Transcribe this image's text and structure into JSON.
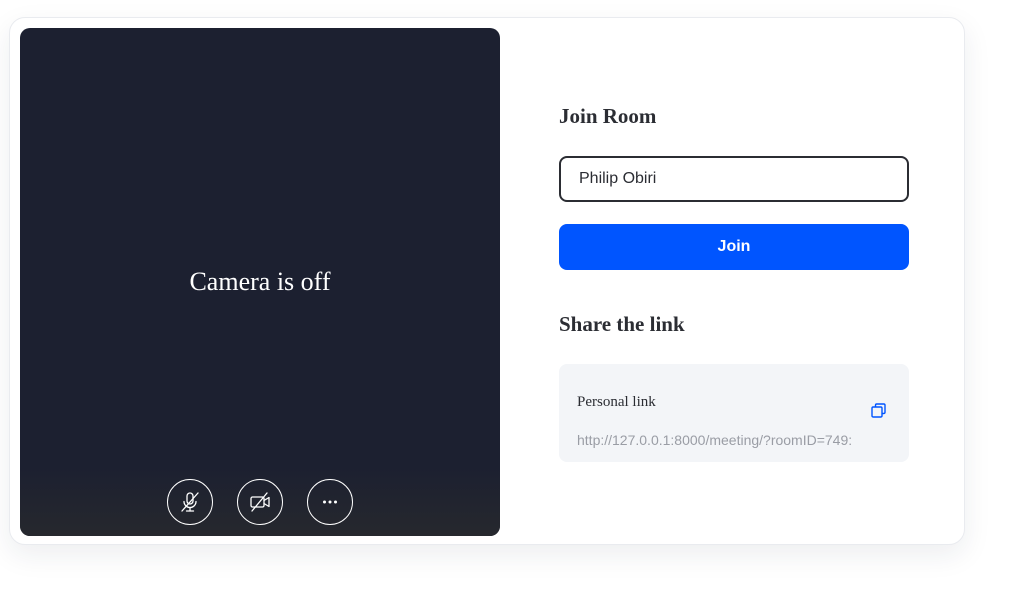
{
  "preview": {
    "camera_status": "Camera is off",
    "controls": [
      {
        "icon": "mic-off-icon",
        "action": "toggle-microphone"
      },
      {
        "icon": "camera-off-icon",
        "action": "toggle-camera"
      },
      {
        "icon": "more-icon",
        "action": "more-options"
      }
    ]
  },
  "join": {
    "heading": "Join Room",
    "name_value": "Philip Obiri",
    "button_label": "Join"
  },
  "share": {
    "heading": "Share the link",
    "link_label": "Personal link",
    "link_url": "http://127.0.0.1:8000/meeting/?roomID=749:"
  },
  "colors": {
    "accent": "#0055ff",
    "preview_background": "#1c2030",
    "link_box_background": "#f3f5f8"
  }
}
